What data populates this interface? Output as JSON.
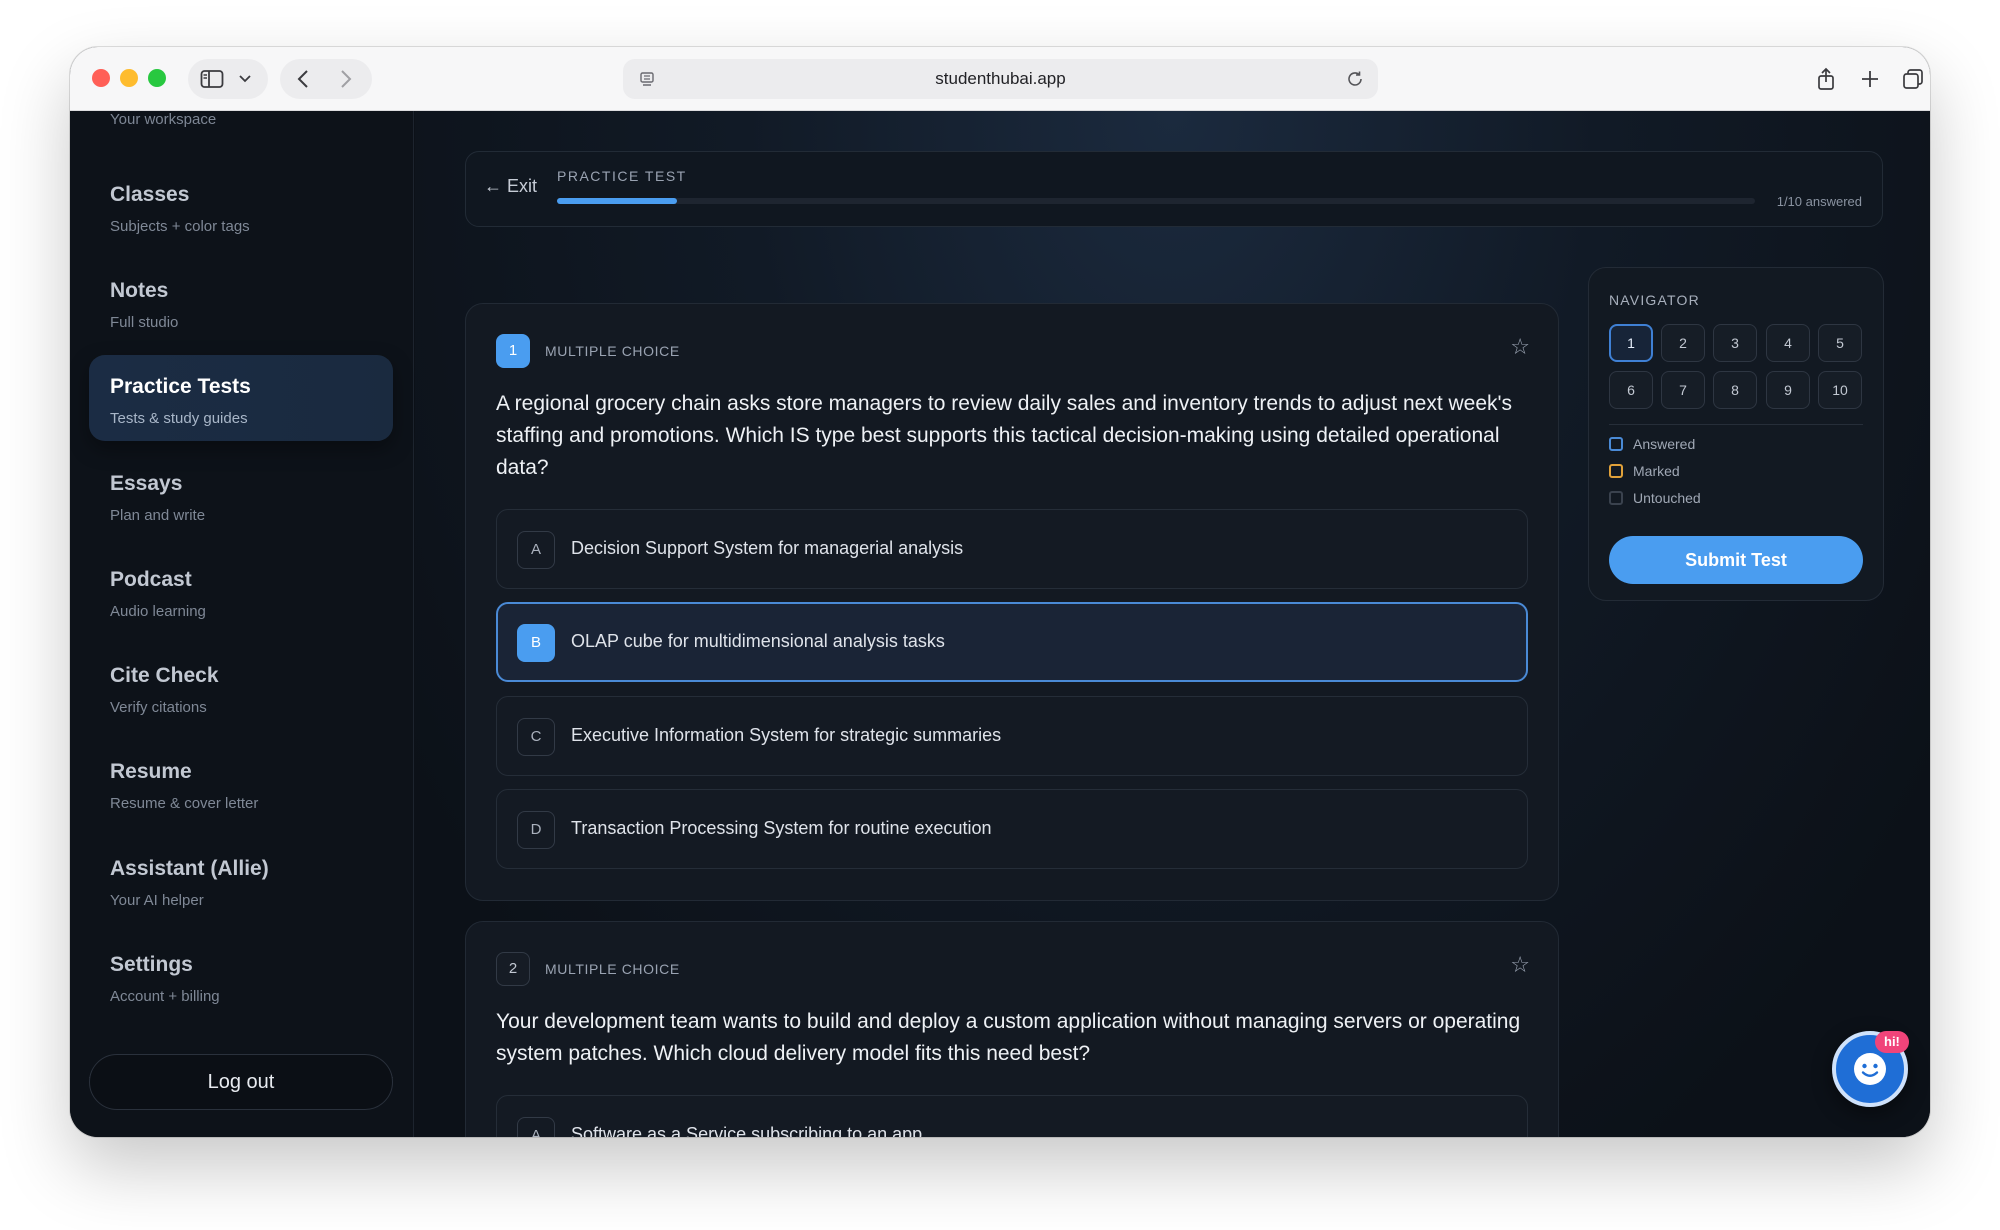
{
  "browser": {
    "url": "studenthubai.app",
    "traffic_light_colors": [
      "#ff5f57",
      "#febc2e",
      "#28c840"
    ]
  },
  "sidebar": {
    "workspace_subtitle": "Your workspace",
    "items": [
      {
        "title": "Classes",
        "subtitle": "Subjects + color tags"
      },
      {
        "title": "Notes",
        "subtitle": "Full studio"
      },
      {
        "title": "Practice Tests",
        "subtitle": "Tests & study guides",
        "active": true
      },
      {
        "title": "Essays",
        "subtitle": "Plan and write"
      },
      {
        "title": "Podcast",
        "subtitle": "Audio learning"
      },
      {
        "title": "Cite Check",
        "subtitle": "Verify citations"
      },
      {
        "title": "Resume",
        "subtitle": "Resume & cover letter"
      },
      {
        "title": "Assistant (Allie)",
        "subtitle": "Your AI helper"
      },
      {
        "title": "Settings",
        "subtitle": "Account + billing"
      }
    ],
    "logout_label": "Log out"
  },
  "header": {
    "exit_label": "← Exit",
    "title": "PRACTICE TEST",
    "progress_fraction": 0.1,
    "answered_text": "1/10 answered"
  },
  "questions": [
    {
      "number": "1",
      "type": "MULTIPLE CHOICE",
      "text": "A regional grocery chain asks store managers to review daily sales and inventory trends to adjust next week's staffing and promotions. Which IS type best supports this tactical decision-making using detailed operational data?",
      "options": [
        {
          "letter": "A",
          "text": "Decision Support System for managerial analysis"
        },
        {
          "letter": "B",
          "text": "OLAP cube for multidimensional analysis tasks",
          "selected": true
        },
        {
          "letter": "C",
          "text": "Executive Information System for strategic summaries"
        },
        {
          "letter": "D",
          "text": "Transaction Processing System for routine execution"
        }
      ]
    },
    {
      "number": "2",
      "type": "MULTIPLE CHOICE",
      "text": "Your development team wants to build and deploy a custom application without managing servers or operating system patches. Which cloud delivery model fits this need best?",
      "options": [
        {
          "letter": "A",
          "text": "Software as a Service subscribing to an app"
        }
      ]
    }
  ],
  "navigator": {
    "title": "NAVIGATOR",
    "cells": [
      "1",
      "2",
      "3",
      "4",
      "5",
      "6",
      "7",
      "8",
      "9",
      "10"
    ],
    "current": "1",
    "legend": [
      {
        "label": "Answered",
        "color": "#4a8ad6"
      },
      {
        "label": "Marked",
        "color": "#e0a13a"
      },
      {
        "label": "Untouched",
        "color": "#3a424e"
      }
    ],
    "submit_label": "Submit Test"
  },
  "chat": {
    "badge": "hi!",
    "icon": "smiley-icon"
  },
  "colors": {
    "accent": "#4a9df0",
    "background": "#0c1118",
    "card": "#131922"
  }
}
